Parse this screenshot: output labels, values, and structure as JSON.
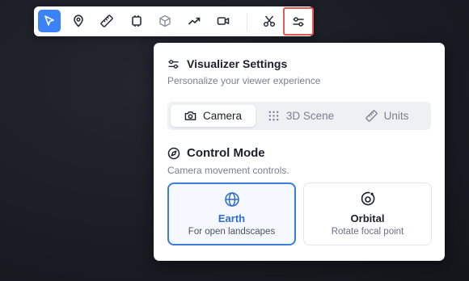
{
  "toolbar": {
    "tools": [
      {
        "name": "select",
        "icon": "cursor-arrow-icon",
        "active": true
      },
      {
        "name": "place-marker",
        "icon": "map-pin-icon"
      },
      {
        "name": "measure",
        "icon": "ruler-icon"
      },
      {
        "name": "area",
        "icon": "frame-icon"
      },
      {
        "name": "3d-object",
        "icon": "cube-icon"
      },
      {
        "name": "path",
        "icon": "trending-line-icon"
      },
      {
        "name": "record",
        "icon": "video-camera-icon"
      },
      {
        "name": "cut",
        "icon": "scissors-icon"
      },
      {
        "name": "settings",
        "icon": "sliders-icon",
        "highlighted": true
      }
    ],
    "accent_color": "#3b82f6",
    "highlight_color": "#e05a5a"
  },
  "panel": {
    "title": "Visualizer Settings",
    "subtitle": "Personalize your viewer experience",
    "tabs": [
      {
        "label": "Camera",
        "icon": "camera-icon",
        "selected": true
      },
      {
        "label": "3D Scene",
        "icon": "grid-dots-icon",
        "selected": false
      },
      {
        "label": "Units",
        "icon": "ruler-icon",
        "selected": false
      }
    ],
    "section": {
      "title": "Control Mode",
      "icon": "compass-icon",
      "subtitle": "Camera movement controls.",
      "options": [
        {
          "name": "Earth",
          "description": "For open landscapes",
          "icon": "globe-icon",
          "selected": true
        },
        {
          "name": "Orbital",
          "description": "Rotate focal point",
          "icon": "orbit-icon",
          "selected": false
        }
      ]
    },
    "selected_color": "#2f6fc9"
  }
}
